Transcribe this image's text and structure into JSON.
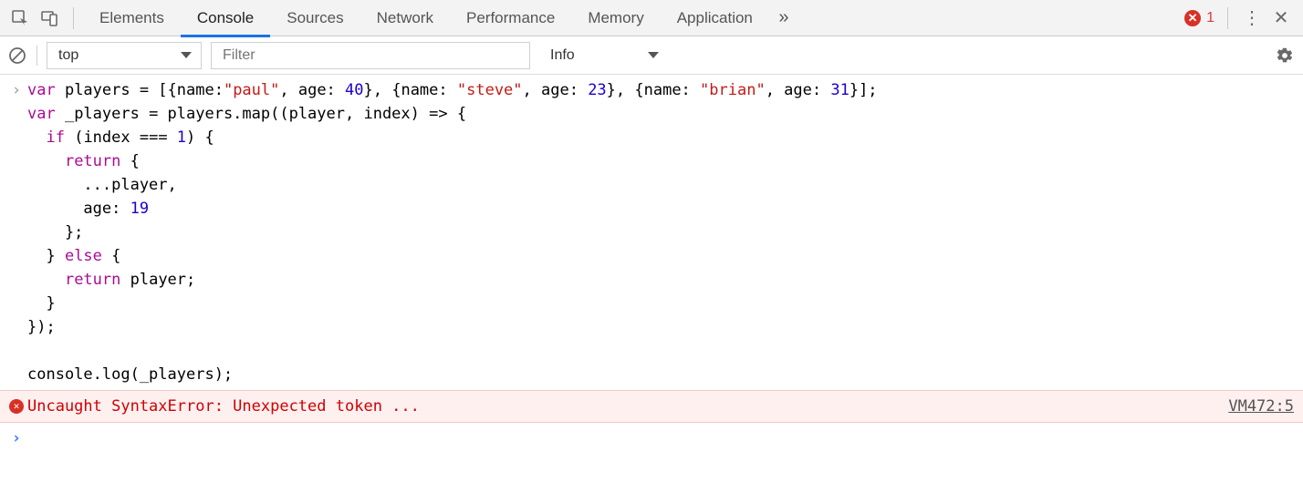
{
  "tabs": {
    "items": [
      "Elements",
      "Console",
      "Sources",
      "Network",
      "Performance",
      "Memory",
      "Application"
    ],
    "active_index": 1
  },
  "errors": {
    "count": "1"
  },
  "toolbar": {
    "context": "top",
    "filter_placeholder": "Filter",
    "level": "Info"
  },
  "code": {
    "line1_pre": "var",
    "line1_mid": " players = [{name:",
    "line1_s1": "\"paul\"",
    "line1_mid2": ", age: ",
    "line1_n1": "40",
    "line1_mid3": "}, {name: ",
    "line1_s2": "\"steve\"",
    "line1_mid4": ", age: ",
    "line1_n2": "23",
    "line1_mid5": "}, {name: ",
    "line1_s3": "\"brian\"",
    "line1_mid6": ", age: ",
    "line1_n3": "31",
    "line1_end": "}];",
    "line2_pre": "var",
    "line2_rest": " _players = players.map((player, index) => {",
    "line3_indent": "  ",
    "line3_kw": "if",
    "line3_rest": " (index === ",
    "line3_num": "1",
    "line3_end": ") {",
    "line4_indent": "    ",
    "line4_kw": "return",
    "line4_rest": " {",
    "line5": "      ...player,",
    "line6_indent": "      age: ",
    "line6_num": "19",
    "line7": "    };",
    "line8_indent": "  } ",
    "line8_kw": "else",
    "line8_rest": " {",
    "line9_indent": "    ",
    "line9_kw": "return",
    "line9_rest": " player;",
    "line10": "  }",
    "line11": "});",
    "line12": "",
    "line13": "console.log(_players);"
  },
  "error": {
    "message": "Uncaught SyntaxError: Unexpected token ...",
    "source": "VM472:5"
  }
}
